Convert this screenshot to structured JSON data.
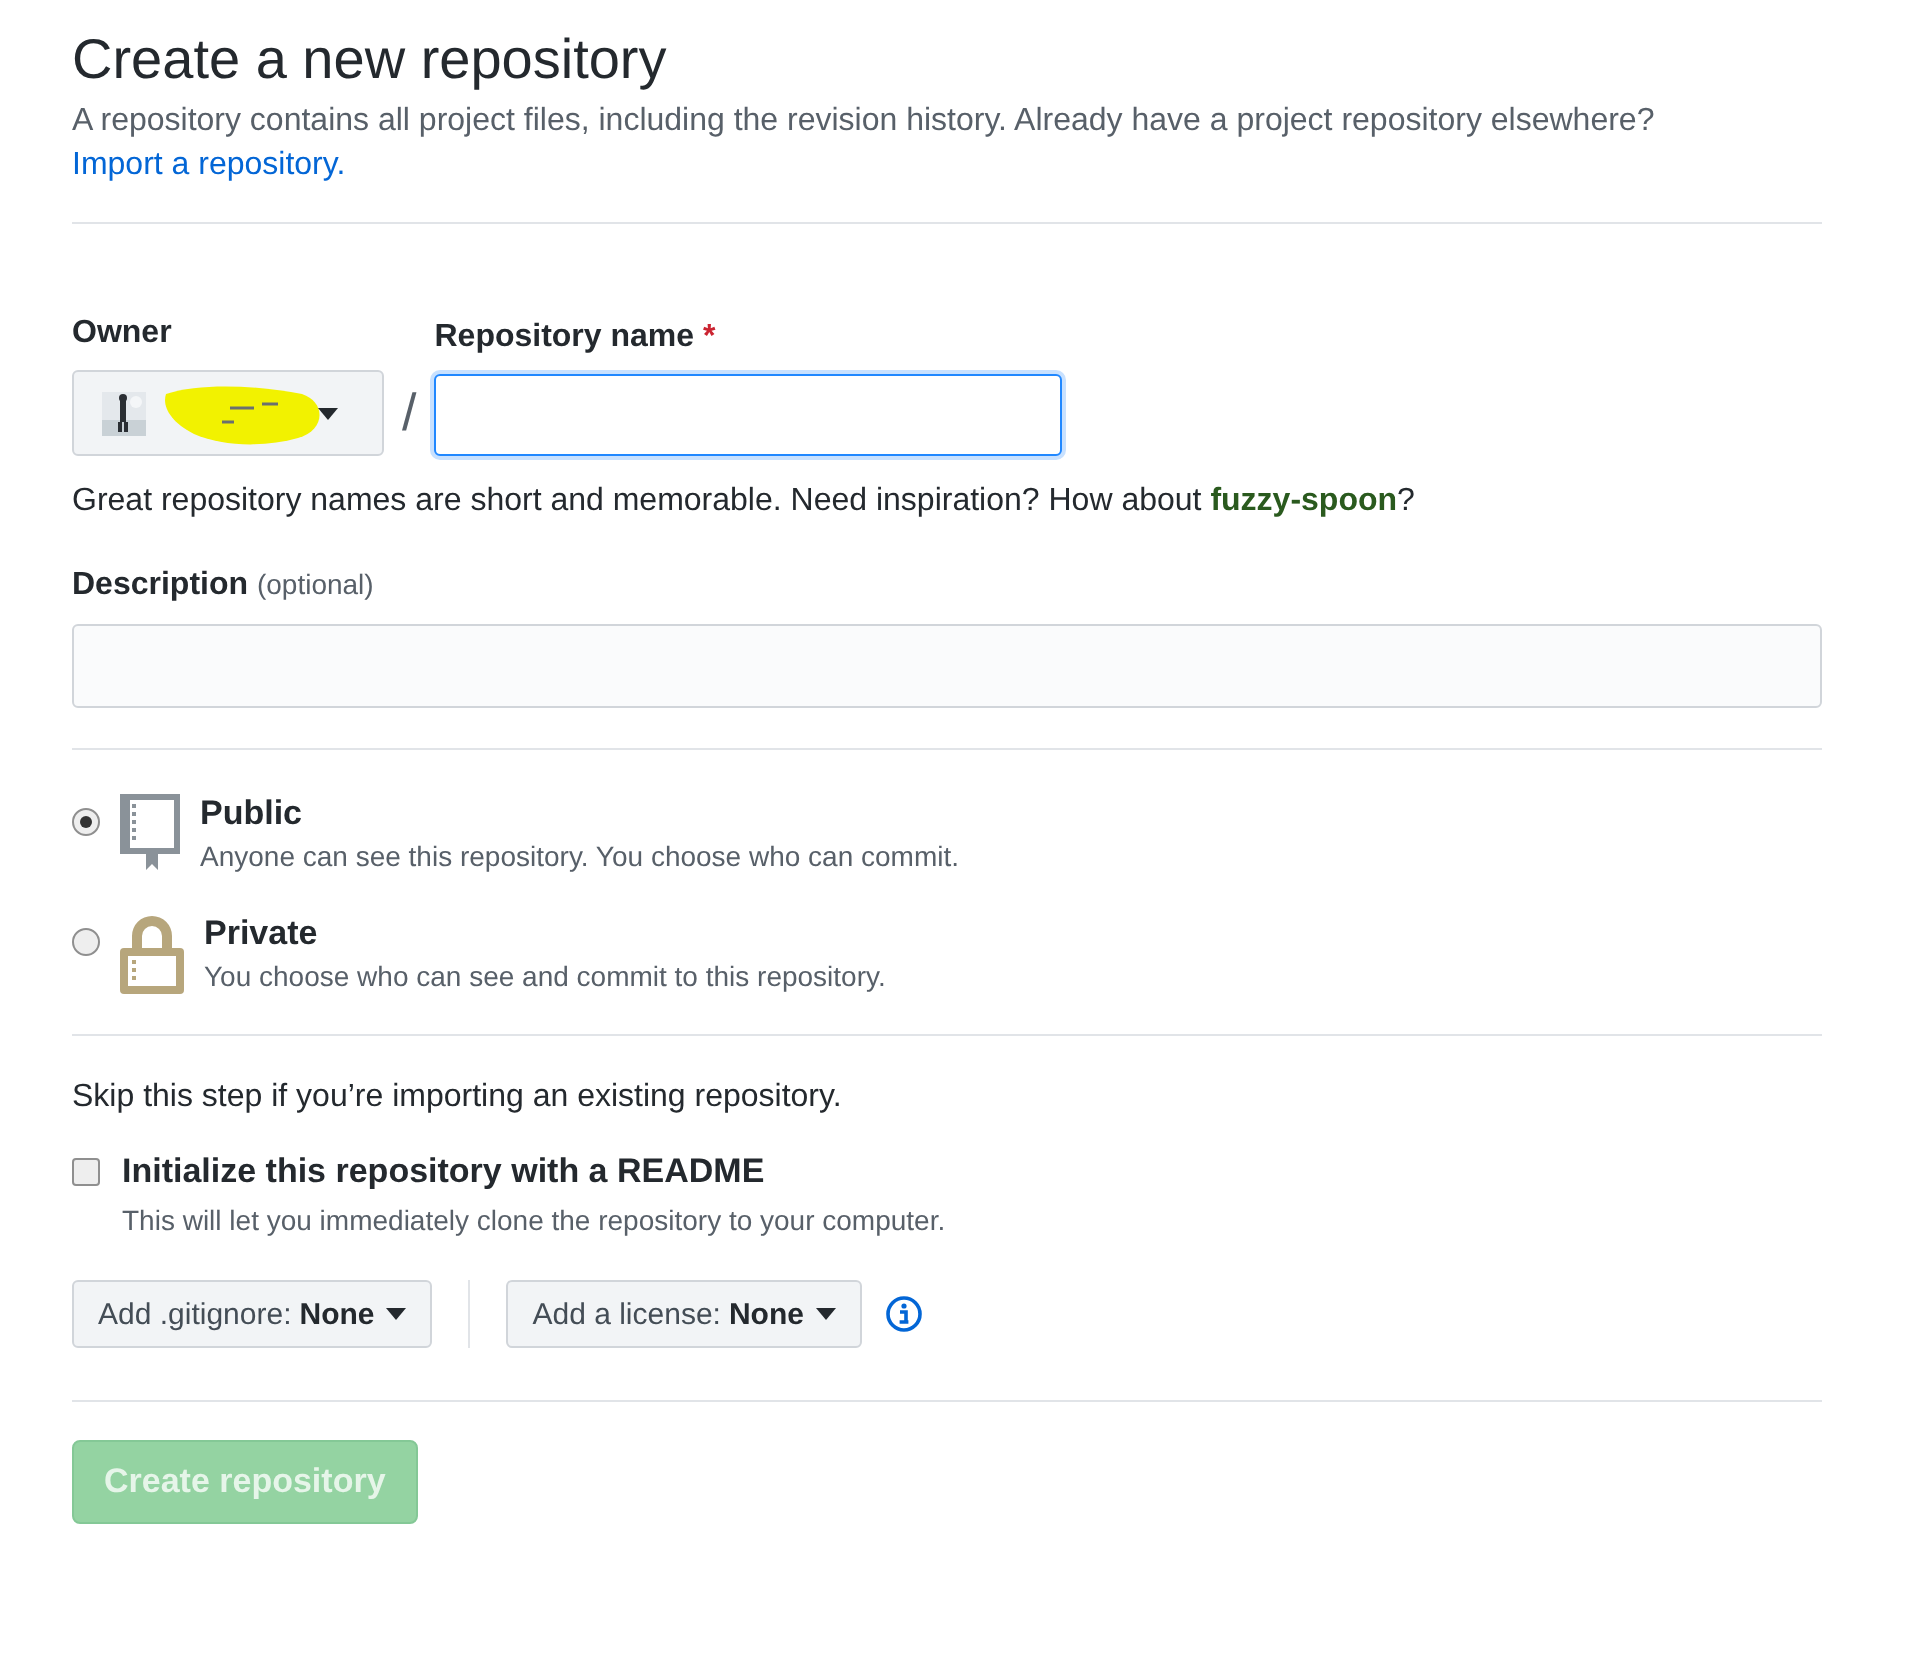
{
  "header": {
    "title": "Create a new repository",
    "description": "A repository contains all project files, including the revision history. Already have a project repository elsewhere?",
    "import_link": "Import a repository."
  },
  "owner": {
    "label": "Owner",
    "redacted": true,
    "separator": "/"
  },
  "repository_name": {
    "label": "Repository name",
    "required_mark": "*",
    "focused": true
  },
  "name_hint": {
    "text": "Great repository names are short and memorable. Need inspiration? How about ",
    "suggestion": "fuzzy-spoon",
    "end": "?"
  },
  "description": {
    "label": "Description",
    "optional": "(optional)"
  },
  "visibility": [
    {
      "kind": "public",
      "title": "Public",
      "text": "Anyone can see this repository. You choose who can commit.",
      "selected": true
    },
    {
      "kind": "private",
      "title": "Private",
      "text": "You choose who can see and commit to this repository.",
      "selected": false
    }
  ],
  "init": {
    "intro": "Skip this step if you’re importing an existing repository.",
    "label": "Initialize this repository with a README",
    "note": "This will let you immediately clone the repository to your computer.",
    "checked": false
  },
  "dropdowns": [
    {
      "label": "Add .gitignore:",
      "value": "None"
    },
    {
      "label": "Add a license:",
      "value": "None"
    }
  ],
  "submit": {
    "label": "Create repository",
    "disabled": true
  }
}
